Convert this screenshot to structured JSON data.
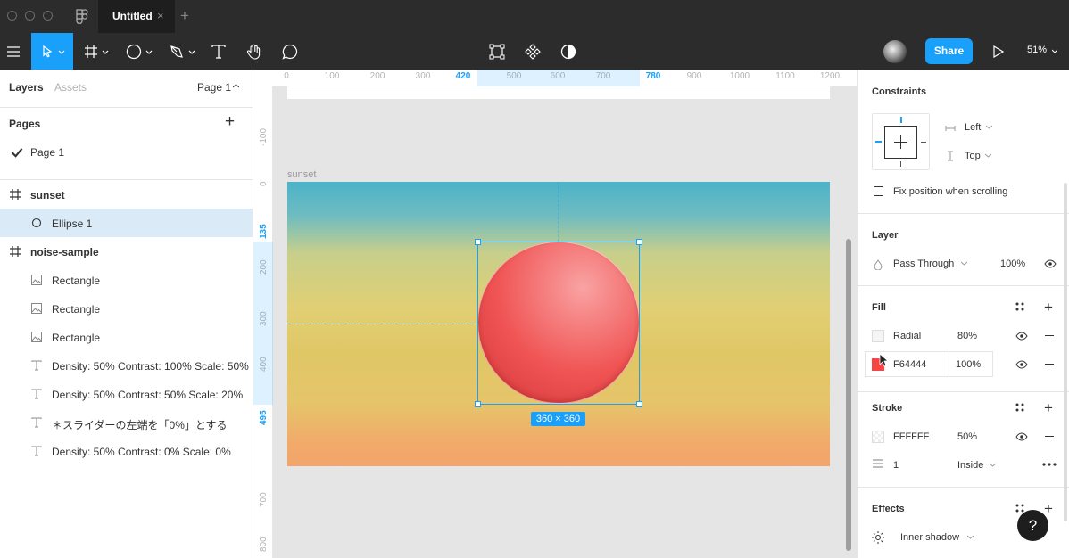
{
  "window": {
    "tab_title": "Untitled",
    "close_glyph": "×",
    "new_tab_glyph": "+"
  },
  "toolbar": {
    "share_label": "Share",
    "zoom_label": "51%",
    "tools": [
      "main-menu-icon",
      "move-tool-icon",
      "frame-tool-icon",
      "shape-tool-icon",
      "pen-tool-icon",
      "text-tool-icon",
      "hand-tool-icon",
      "comment-tool-icon",
      "transform-icon",
      "component-icon",
      "mask-icon",
      "present-icon"
    ]
  },
  "left_panel": {
    "tab_layers": "Layers",
    "tab_assets": "Assets",
    "page_selector": "Page 1",
    "pages_title": "Pages",
    "add_page": "+",
    "pages": [
      {
        "label": "Page 1",
        "checked": true
      }
    ],
    "layers": [
      {
        "label": "sunset",
        "type": "frame",
        "indent": 0,
        "selected": false
      },
      {
        "label": "Ellipse 1",
        "type": "ellipse",
        "indent": 1,
        "selected": true
      },
      {
        "label": "noise-sample",
        "type": "frame",
        "indent": 0,
        "selected": false
      },
      {
        "label": "Rectangle",
        "type": "image",
        "indent": 1,
        "selected": false
      },
      {
        "label": "Rectangle",
        "type": "image",
        "indent": 1,
        "selected": false
      },
      {
        "label": "Rectangle",
        "type": "image",
        "indent": 1,
        "selected": false
      },
      {
        "label": "Density: 50% Contrast: 100% Scale: 50%",
        "type": "text",
        "indent": 1,
        "selected": false
      },
      {
        "label": "Density: 50% Contrast: 50% Scale: 20%",
        "type": "text",
        "indent": 1,
        "selected": false
      },
      {
        "label": "＊スライダーの左端を「0%」とする",
        "type": "text",
        "indent": 1,
        "selected": false
      },
      {
        "label": "Density: 50% Contrast: 0% Scale: 0%",
        "type": "text",
        "indent": 1,
        "selected": false
      }
    ]
  },
  "canvas": {
    "frame_label": "sunset",
    "size_badge": "360 × 360",
    "ruler_top": [
      "0",
      "100",
      "200",
      "300",
      "420",
      "500",
      "600",
      "700",
      "780",
      "900",
      "1000",
      "1100",
      "1200"
    ],
    "ruler_top_highlight": [
      "420",
      "780"
    ],
    "ruler_left": [
      "-100",
      "0",
      "135",
      "200",
      "300",
      "400",
      "495",
      "700",
      "800"
    ],
    "ruler_left_highlight": [
      "135",
      "495"
    ]
  },
  "right_panel": {
    "constraints_title": "Constraints",
    "constraint_h": "Left",
    "constraint_v": "Top",
    "fix_position": "Fix position when scrolling",
    "layer_title": "Layer",
    "blend_mode": "Pass Through",
    "layer_opacity": "100%",
    "fill_title": "Fill",
    "fills": [
      {
        "type": "Radial",
        "opacity": "80%",
        "color": "#f5f5f5"
      },
      {
        "type": "F64444",
        "opacity": "100%",
        "color": "#F64444"
      }
    ],
    "stroke_title": "Stroke",
    "stroke_color": "FFFFFF",
    "stroke_opacity": "50%",
    "stroke_weight": "1",
    "stroke_align": "Inside",
    "effects_title": "Effects",
    "effect_type": "Inner shadow",
    "help_label": "?"
  },
  "colors": {
    "accent": "#18a0fb",
    "toolbar": "#2c2c2c",
    "selection_bg": "#daebf7"
  }
}
